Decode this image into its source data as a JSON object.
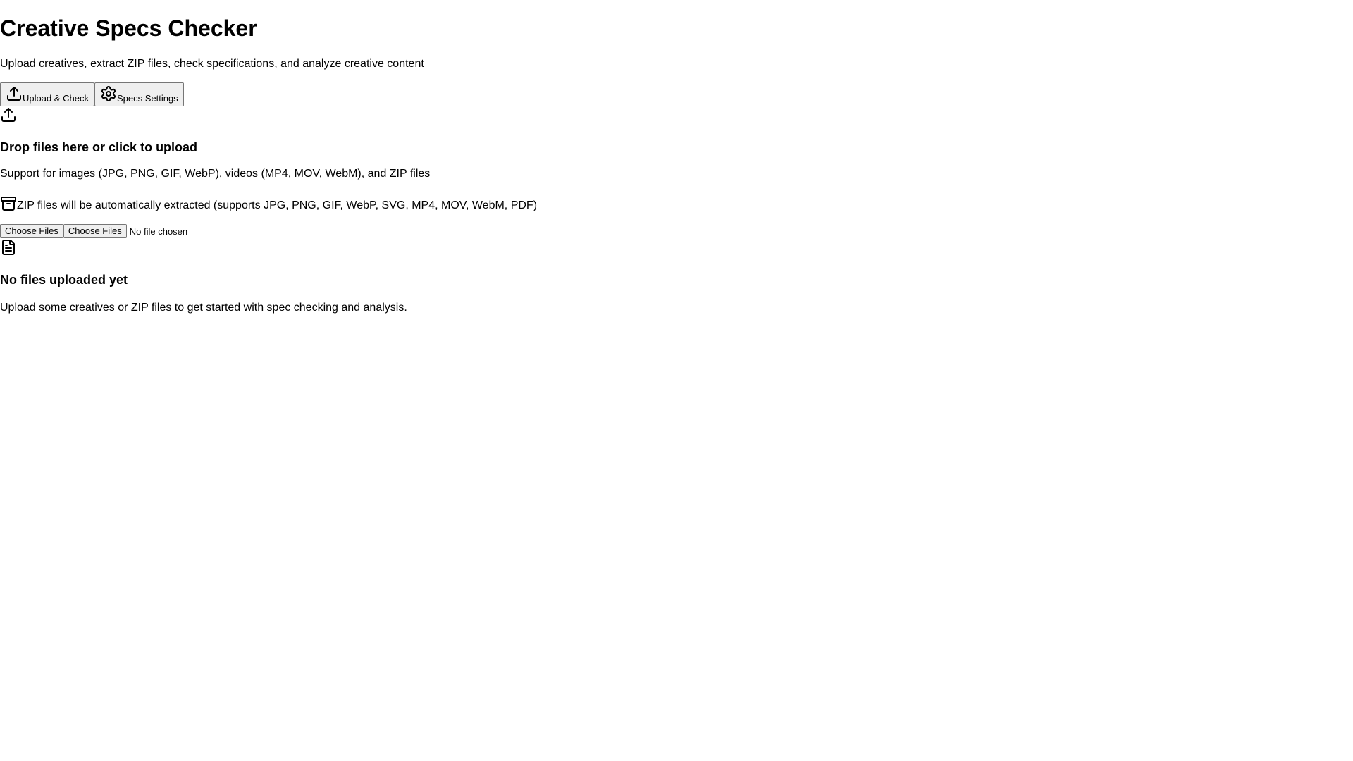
{
  "header": {
    "title": "Creative Specs Checker",
    "subtitle": "Upload creatives, extract ZIP files, check specifications, and analyze creative content"
  },
  "tabs": [
    {
      "label": "Upload & Check",
      "icon": "upload-icon"
    },
    {
      "label": "Specs Settings",
      "icon": "gear-icon"
    }
  ],
  "dropzone": {
    "icon": "upload-icon",
    "heading": "Drop files here or click to upload",
    "support_text": "Support for images (JPG, PNG, GIF, WebP), videos (MP4, MOV, WebM), and ZIP files",
    "zip_icon": "archive-icon",
    "zip_note": "ZIP files will be automatically extracted (supports JPG, PNG, GIF, WebP, SVG, MP4, MOV, WebM, PDF)",
    "choose_button_label": "Choose Files",
    "file_input_button_label": "Choose Files",
    "file_status": "No file chosen"
  },
  "empty_state": {
    "icon": "file-text-icon",
    "heading": "No files uploaded yet",
    "text": "Upload some creatives or ZIP files to get started with spec checking and analysis."
  }
}
